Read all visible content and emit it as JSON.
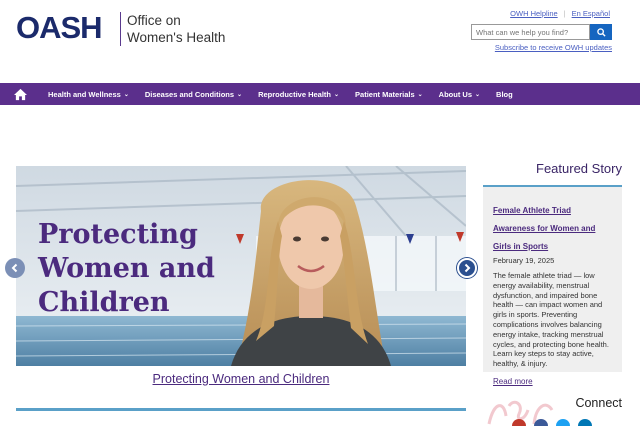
{
  "header": {
    "logo": "OASH",
    "title_line1": "Office on",
    "title_line2": "Women's Health",
    "helpline_link": "OWH Helpline",
    "espanol_link": "En Español",
    "search_placeholder": "What can we help you find?",
    "subscribe_link": "Subscribe to receive OWH updates"
  },
  "nav": {
    "items": [
      {
        "label": "Health and Wellness",
        "has_dropdown": true
      },
      {
        "label": "Diseases and Conditions",
        "has_dropdown": true
      },
      {
        "label": "Reproductive Health",
        "has_dropdown": true
      },
      {
        "label": "Patient Materials",
        "has_dropdown": true
      },
      {
        "label": "About Us",
        "has_dropdown": true
      },
      {
        "label": "Blog",
        "has_dropdown": false
      }
    ],
    "caret": "⌄"
  },
  "hero": {
    "title_line1": "Protecting",
    "title_line2": "Women and",
    "title_line3": "Children",
    "caption": "Protecting Women and Children"
  },
  "featured": {
    "heading": "Featured Story",
    "card_title": "Female Athlete Triad Awareness for Women and Girls in Sports",
    "date": "February 19, 2025",
    "body": "The female athlete triad — low energy availability, menstrual dysfunction, and impaired bone health — can impact women and girls in sports. Preventing complications involves balancing energy intake, tracking menstrual cycles, and protecting bone health. Learn key steps to stay active, healthy, & injury.",
    "read_more": "Read more"
  },
  "connect": {
    "heading": "Connect"
  },
  "colors": {
    "brand_purple": "#5b2f8c",
    "logo_navy": "#1b2a6b",
    "link_blue": "#4a5fc1",
    "accent_blue": "#5aa0c8"
  }
}
